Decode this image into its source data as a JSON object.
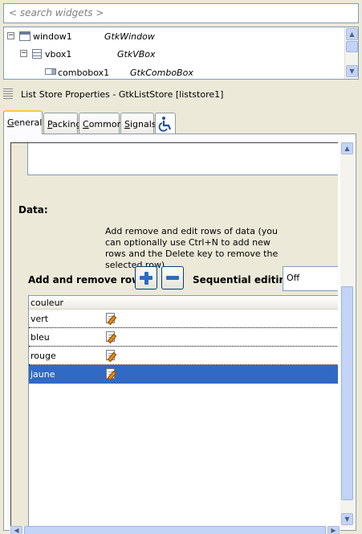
{
  "search": {
    "placeholder": "< search widgets >"
  },
  "tree": {
    "rows": [
      {
        "name": "window1",
        "class": "GtkWindow",
        "expander": "−",
        "icon": "window-icon"
      },
      {
        "name": "vbox1",
        "class": "GtkVBox",
        "expander": "−",
        "icon": "vbox-icon"
      },
      {
        "name": "combobox1",
        "class": "GtkComboBox",
        "expander": "",
        "icon": "combobox-icon"
      }
    ]
  },
  "properties": {
    "title": "List Store Properties - GtkListStore [liststore1]"
  },
  "tabs": [
    {
      "label": "General",
      "mnemonic": "G",
      "rest": "eneral",
      "active": true
    },
    {
      "label": "Packing",
      "mnemonic": "P",
      "rest": "acking",
      "active": false
    },
    {
      "label": "Common",
      "mnemonic": "C",
      "rest": "ommon",
      "active": false
    },
    {
      "label": "Signals",
      "mnemonic": "S",
      "rest": "ignals",
      "active": false
    }
  ],
  "data_section": {
    "label": "Data:",
    "help": "Add remove and edit rows of data (you can optionally use Ctrl+N to add new rows and the Delete key to remove the selected row)",
    "add_remove_label": "Add and remove rows:",
    "sequential_label": "Sequential editing:",
    "sequential_value": "Off"
  },
  "list": {
    "column": "couleur",
    "rows": [
      {
        "value": "vert",
        "selected": false
      },
      {
        "value": "bleu",
        "selected": false
      },
      {
        "value": "rouge",
        "selected": false
      },
      {
        "value": "jaune",
        "selected": true
      }
    ]
  },
  "icons": {
    "add": "plus-icon",
    "remove": "minus-icon",
    "accessibility": "wheelchair-icon",
    "edit": "pencil-icon"
  },
  "colors": {
    "selection": "#316ac5",
    "active_tab_accent": "#ffc83c",
    "button_icon": "#2c6cc4"
  }
}
